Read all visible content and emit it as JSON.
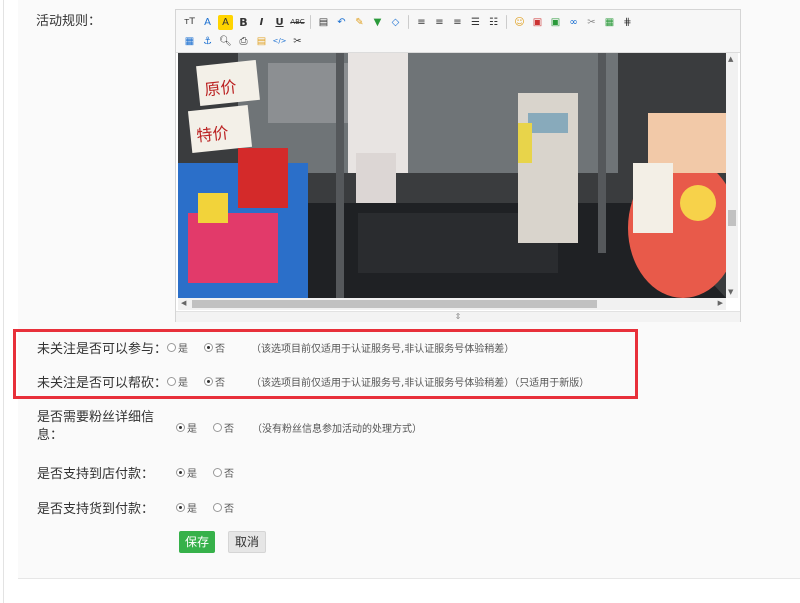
{
  "form": {
    "rules_label": "活动规则：",
    "unfollow_join": {
      "label": "未关注是否可以参与：",
      "opt_yes": "是",
      "opt_no": "否",
      "selected": "否",
      "hint": "（该选项目前仅适用于认证服务号,非认证服务号体验稍差）"
    },
    "unfollow_help": {
      "label": "未关注是否可以帮砍：",
      "opt_yes": "是",
      "opt_no": "否",
      "selected": "否",
      "hint": "（该选项目前仅适用于认证服务号,非认证服务号体验稍差）（只适用于新版）"
    },
    "need_fans_info": {
      "label_line1": "是否需要粉丝详细信",
      "label_line2": "息：",
      "opt_yes": "是",
      "opt_no": "否",
      "selected": "是",
      "hint": "（没有粉丝信息参加活动的处理方式）"
    },
    "store_pay": {
      "label": "是否支持到店付款：",
      "opt_yes": "是",
      "opt_no": "否",
      "selected": "是"
    },
    "cod": {
      "label": "是否支持货到付款：",
      "opt_yes": "是",
      "opt_no": "否",
      "selected": "是"
    },
    "save_label": "保存",
    "cancel_label": "取消"
  },
  "editor": {
    "image_text_1": "原价",
    "image_text_2": "特价",
    "resize_glyph": "⇕",
    "toolbar_row1": [
      "font-size-icon",
      "font-color-icon",
      "highlight-icon",
      "bold-icon",
      "italic-icon",
      "underline-icon",
      "strikethrough-icon",
      "sep",
      "paste-icon",
      "undo-icon",
      "eraser-icon",
      "insert-icon",
      "clear-format-icon",
      "sep",
      "align-left-icon",
      "align-center-icon",
      "align-right-icon",
      "ordered-list-icon",
      "unordered-list-icon",
      "sep",
      "emoji-icon",
      "image-icon",
      "flash-icon",
      "link-icon",
      "unlink-icon",
      "map-icon",
      "hr-icon"
    ],
    "toolbar_row2": [
      "table-icon",
      "anchor-icon",
      "preview-icon",
      "print-icon",
      "template-icon",
      "code-icon",
      "cut-icon"
    ]
  },
  "colors": {
    "highlight_border": "#e8303a",
    "save_button": "#36b14a",
    "cancel_button": "#e6e6e6"
  }
}
